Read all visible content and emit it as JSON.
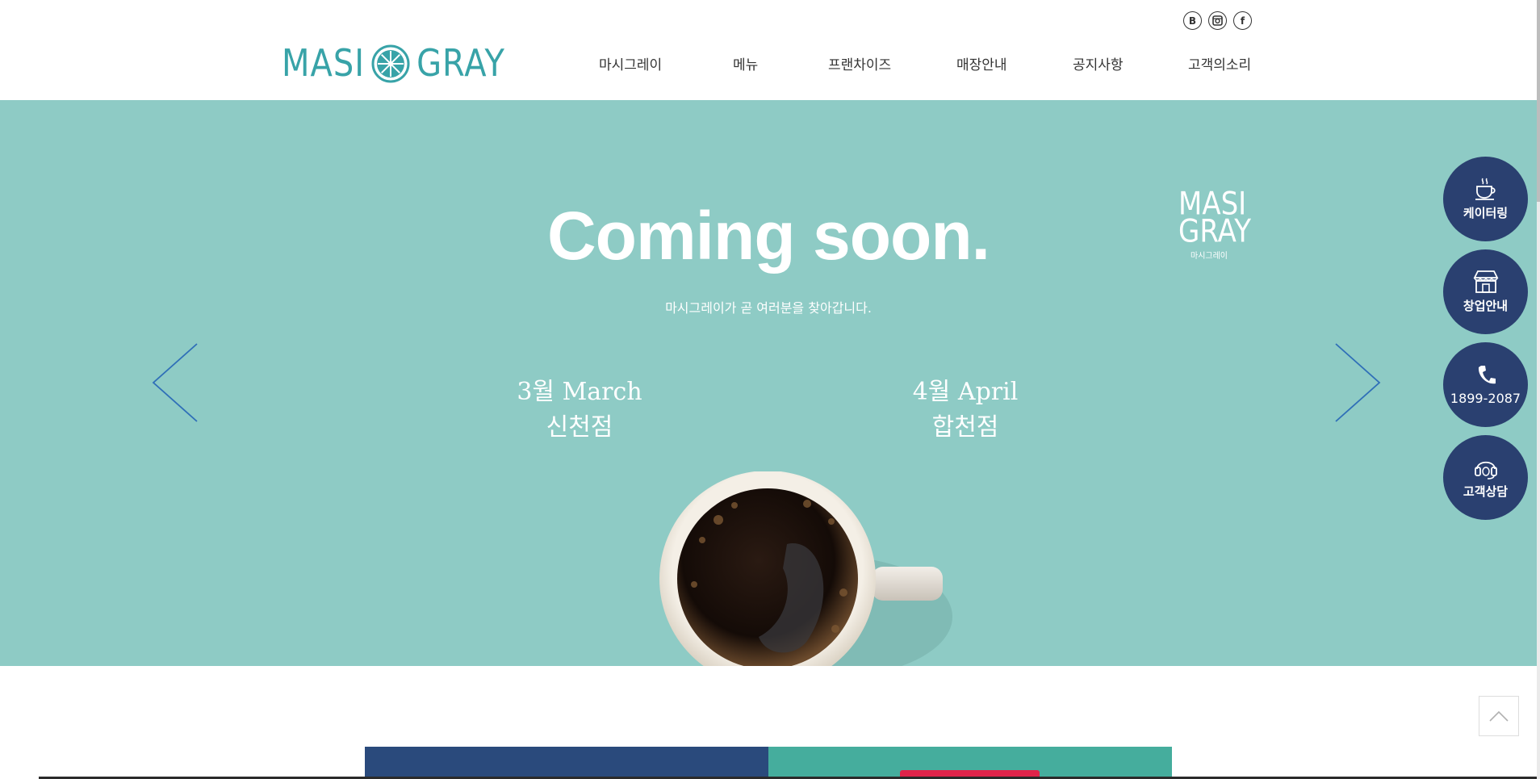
{
  "header": {
    "logo": {
      "left": "MASI",
      "right": "GRAY"
    },
    "sns": [
      {
        "name": "blog-icon",
        "glyph": "B"
      },
      {
        "name": "instagram-icon",
        "glyph": "◙"
      },
      {
        "name": "facebook-icon",
        "glyph": "f"
      }
    ],
    "nav": [
      "마시그레이",
      "메뉴",
      "프랜차이즈",
      "매장안내",
      "공지사항",
      "고객의소리"
    ]
  },
  "hero": {
    "title": "Coming soon.",
    "subtitle": "마시그레이가 곧 여러분을 찾아갑니다.",
    "mini_logo": {
      "line1": "MASI",
      "line2": "GRAY",
      "sub": "마시그레이"
    },
    "schedule": [
      {
        "date": "3월 March",
        "store": "신천점"
      },
      {
        "date": "4월 April",
        "store": "합천점"
      }
    ]
  },
  "quick_menu": [
    {
      "label": "케이터링",
      "icon": "coffee-cup-icon"
    },
    {
      "label": "창업안내",
      "icon": "store-icon"
    },
    {
      "label": "1899-2087",
      "icon": "phone-icon"
    },
    {
      "label": "고객상담",
      "icon": "headset-icon"
    }
  ],
  "colors": {
    "brand_teal": "#38a3a8",
    "hero_bg": "#8ecbc5",
    "quick_menu_bg": "#2a4070",
    "arrow": "#2f6fb8"
  }
}
